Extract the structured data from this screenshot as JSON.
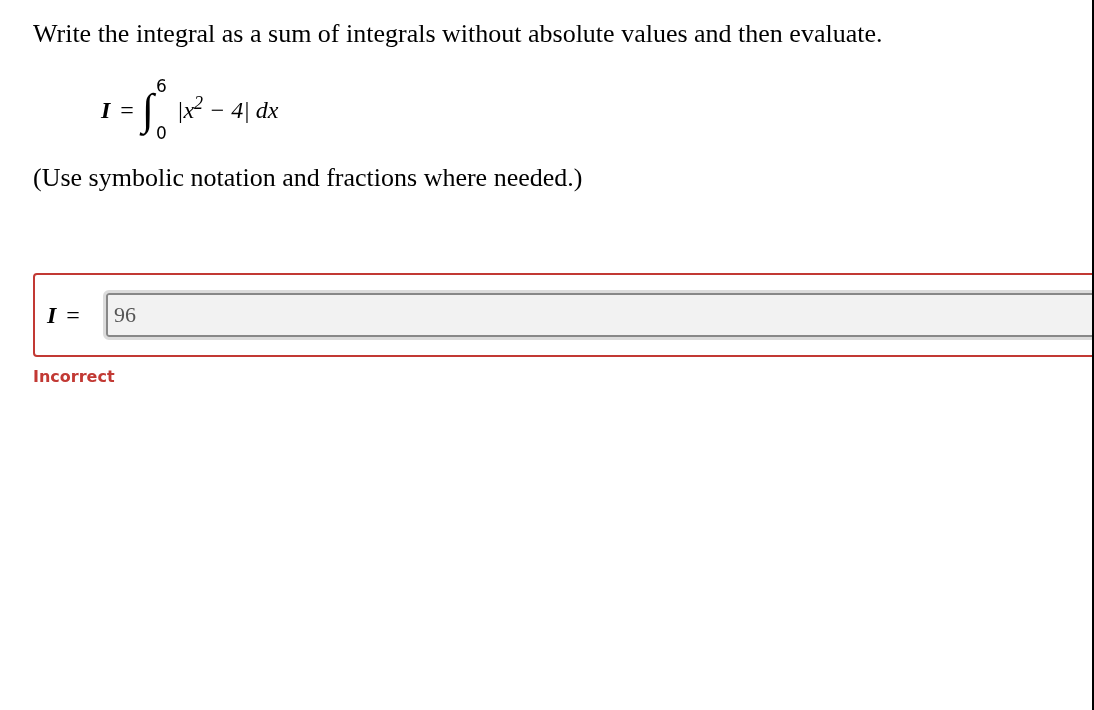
{
  "question": {
    "prompt": "Write the integral as a sum of integrals without absolute values and then evaluate.",
    "formula": {
      "lhs": "I",
      "equals": "=",
      "integral_sign": "∫",
      "upper_limit": "6",
      "lower_limit": "0",
      "integrand": "|x$^{2}$ − 4|",
      "differential": "dx"
    },
    "note": "(Use symbolic notation and fractions where needed.)"
  },
  "answer": {
    "label": "I",
    "equals": "=",
    "value": "96",
    "incorrect": true,
    "feedback": "Incorrect"
  }
}
